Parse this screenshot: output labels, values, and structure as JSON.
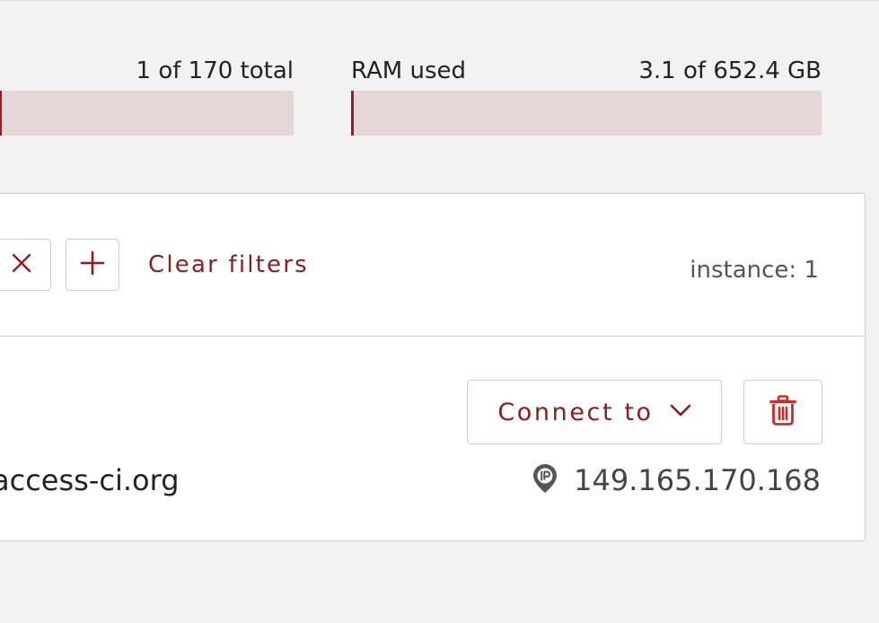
{
  "quotas": {
    "instances": {
      "summary": "1 of 170 total",
      "used_fraction": 0.0059
    },
    "ram": {
      "label": "RAM used",
      "summary": "3.1 of 652.4 GB",
      "used_fraction": 0.0048
    }
  },
  "filters": {
    "clear_label": "Clear filters",
    "instance_count": "instance: 1"
  },
  "instance": {
    "hostname": "access-ci.org",
    "ip_address": "149.165.170.168",
    "connect_label": "Connect to"
  },
  "colors": {
    "accent": "#8e1b1f",
    "bar_track": "#e5d6d8",
    "bar_fill": "#9b1b22",
    "delete_icon": "#d12a2a"
  },
  "icons": {
    "remove_filter": "close-icon",
    "add_filter": "plus-icon",
    "connect_menu": "chevron-down-icon",
    "delete": "trash-icon",
    "ip": "ip-pin-icon"
  }
}
